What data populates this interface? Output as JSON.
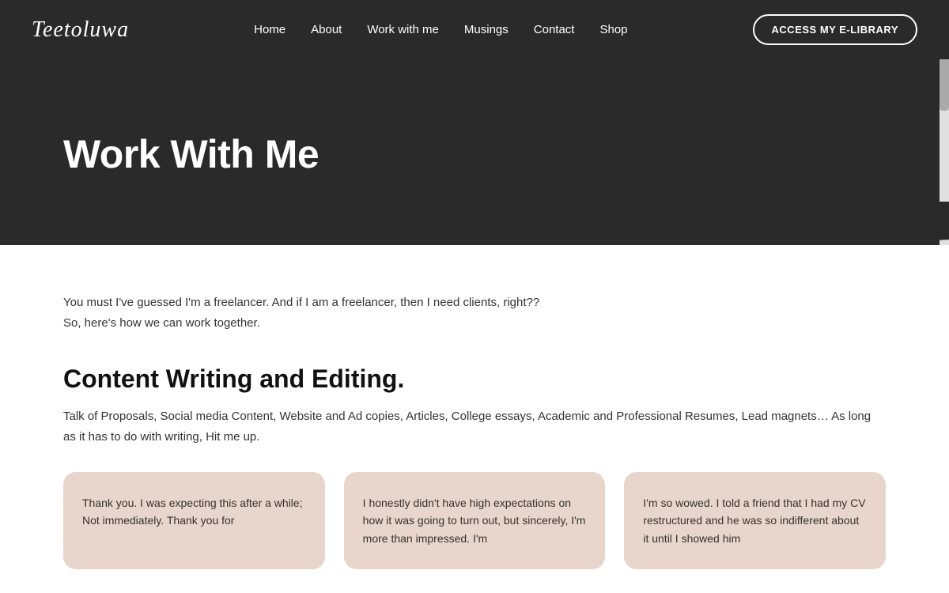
{
  "header": {
    "logo": "Teetoluwa",
    "nav": {
      "items": [
        {
          "label": "Home",
          "id": "home"
        },
        {
          "label": "About",
          "id": "about"
        },
        {
          "label": "Work with me",
          "id": "work-with-me"
        },
        {
          "label": "Musings",
          "id": "musings"
        },
        {
          "label": "Contact",
          "id": "contact"
        },
        {
          "label": "Shop",
          "id": "shop"
        }
      ]
    },
    "cta_button": "ACCESS MY E-LIBRARY"
  },
  "hero": {
    "title": "Work With Me"
  },
  "main": {
    "intro_line1": "You must I've guessed I'm a freelancer. And if I am a freelancer, then I need clients, right??",
    "intro_line2": "So, here's how we can work together.",
    "section_title": "Content Writing and Editing.",
    "section_desc": "Talk of Proposals, Social media Content, Website and Ad copies, Articles, College essays, Academic and Professional Resumes, Lead magnets… As long as it has to do with writing, Hit me up.",
    "cards": [
      {
        "text": "Thank you. I was expecting this after a while; Not immediately. Thank you for"
      },
      {
        "text": "I honestly didn't have high expectations on how it was going to turn out, but sincerely, I'm more than impressed. I'm"
      },
      {
        "text": "I'm so wowed. I told a friend that I had my CV restructured and he was so indifferent about it until I showed him"
      }
    ]
  }
}
